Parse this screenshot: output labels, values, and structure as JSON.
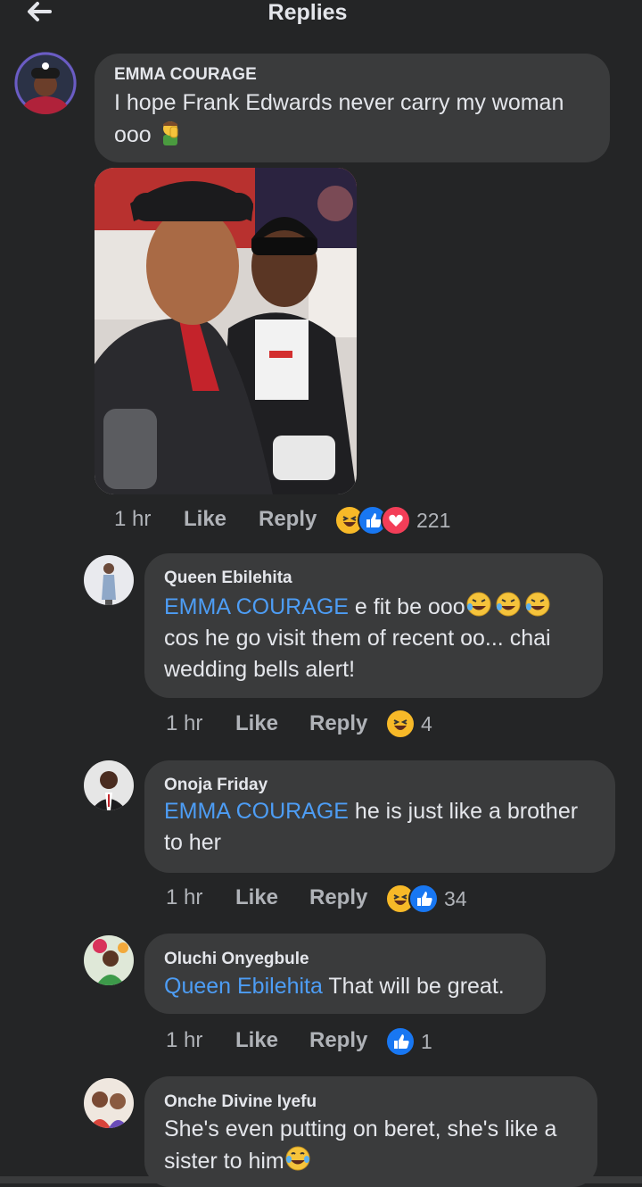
{
  "header": {
    "title": "Replies"
  },
  "colors": {
    "background": "#242526",
    "bubble": "#3a3b3c",
    "mention": "#4d9df5",
    "like_blue": "#1877f2",
    "love_red": "#f33e58",
    "haha_yellow": "#f7b928"
  },
  "main_comment": {
    "author": "EMMA COURAGE",
    "text": "I hope Frank Edwards never carry my woman ooo",
    "emoji": "man-facepalming",
    "has_photo": true,
    "time": "1 hr",
    "like_label": "Like",
    "reply_label": "Reply",
    "reactions": [
      "haha",
      "like",
      "love"
    ],
    "reaction_count": "221"
  },
  "replies": [
    {
      "author": "Queen Ebilehita",
      "mention": "EMMA COURAGE",
      "text_line1": " e fit be ooo",
      "text_line2": "cos he go visit them of recent oo... chai",
      "text_line3": "wedding bells alert!",
      "emoji": "rolling-laughing x3",
      "time": "1 hr",
      "like_label": "Like",
      "reply_label": "Reply",
      "reactions": [
        "haha"
      ],
      "reaction_count": "4"
    },
    {
      "author": "Onoja Friday",
      "mention": "EMMA COURAGE",
      "text_line1": " he is just like a brother",
      "text_line2": "to her",
      "time": "1 hr",
      "like_label": "Like",
      "reply_label": "Reply",
      "reactions": [
        "haha",
        "like"
      ],
      "reaction_count": "34"
    },
    {
      "author": "Oluchi Onyegbule",
      "mention": "Queen Ebilehita",
      "text_line1": " That will be great.",
      "time": "1 hr",
      "like_label": "Like",
      "reply_label": "Reply",
      "reactions": [
        "like"
      ],
      "reaction_count": "1"
    },
    {
      "author": "Onche Divine Iyefu",
      "text_line1": "She's even putting on beret, she's like a",
      "text_line2": "sister to him",
      "emoji": "tears-of-joy"
    }
  ]
}
